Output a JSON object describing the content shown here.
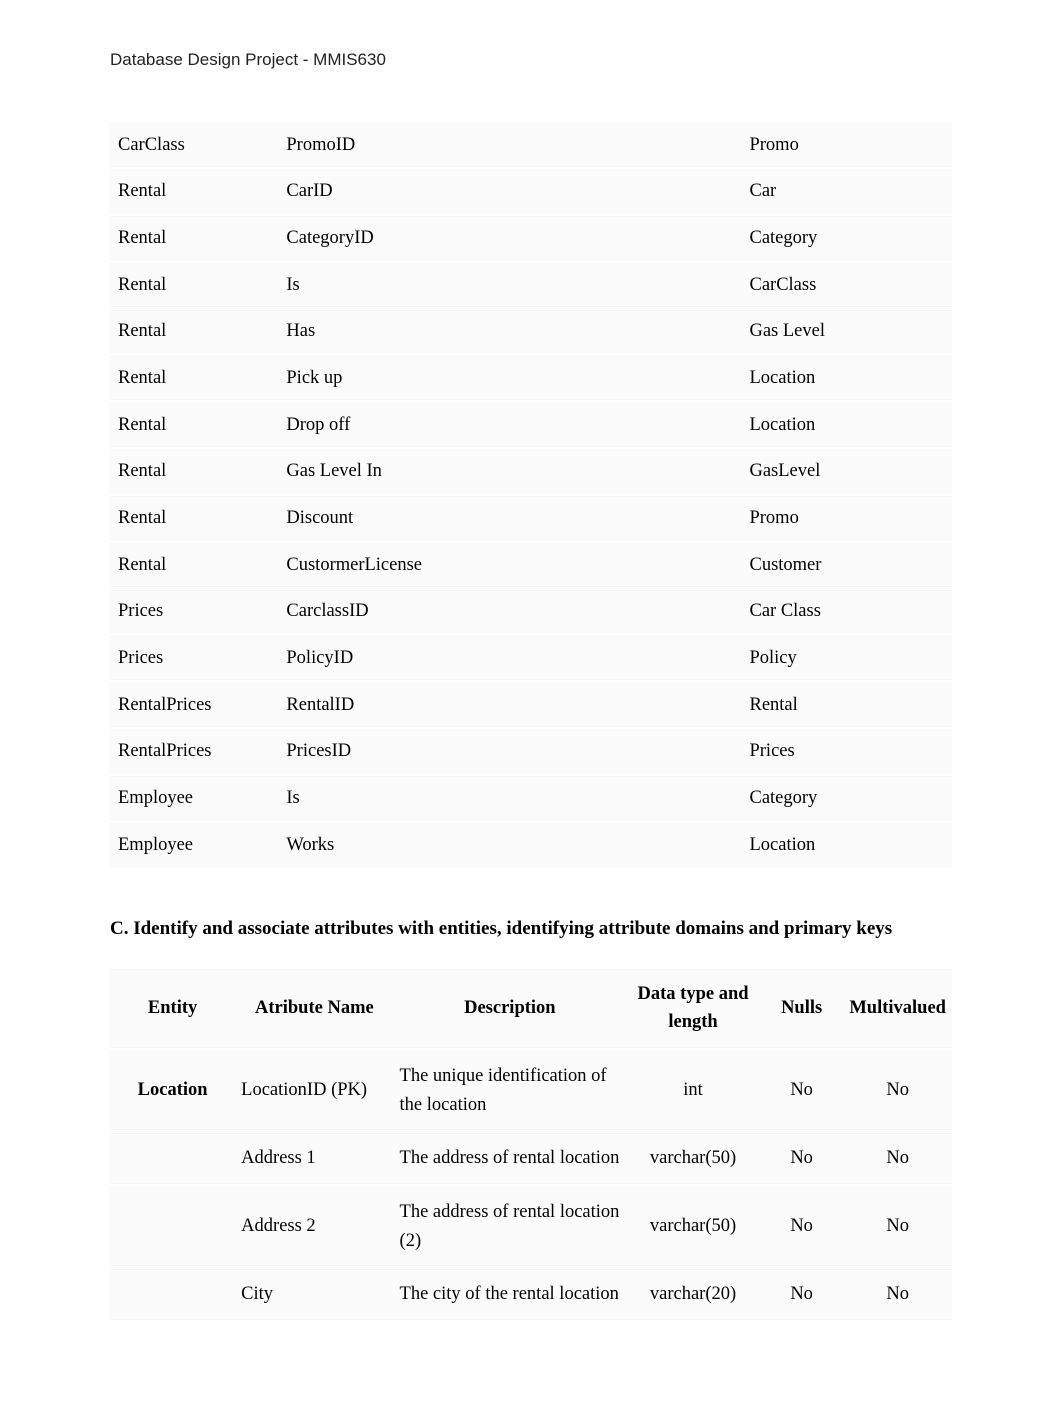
{
  "page_header": "Database Design Project - MMIS630",
  "relationship_rows": [
    {
      "left": "CarClass",
      "middle": "PromoID",
      "right": "Promo"
    },
    {
      "left": "Rental",
      "middle": "CarID",
      "right": "Car"
    },
    {
      "left": "Rental",
      "middle": "CategoryID",
      "right": "Category"
    },
    {
      "left": "Rental",
      "middle": "Is",
      "right": "CarClass"
    },
    {
      "left": "Rental",
      "middle": "Has",
      "right": "Gas Level"
    },
    {
      "left": "Rental",
      "middle": "Pick up",
      "right": "Location"
    },
    {
      "left": "Rental",
      "middle": "Drop off",
      "right": "Location"
    },
    {
      "left": "Rental",
      "middle": "Gas Level In",
      "right": "GasLevel"
    },
    {
      "left": "Rental",
      "middle": "Discount",
      "right": "Promo"
    },
    {
      "left": "Rental",
      "middle": "CustormerLicense",
      "right": "Customer"
    },
    {
      "left": "Prices",
      "middle": "CarclassID",
      "right": "Car Class"
    },
    {
      "left": "Prices",
      "middle": "PolicyID",
      "right": "Policy"
    },
    {
      "left": "RentalPrices",
      "middle": "RentalID",
      "right": "Rental"
    },
    {
      "left": "RentalPrices",
      "middle": "PricesID",
      "right": "Prices"
    },
    {
      "left": "Employee",
      "middle": "Is",
      "right": "Category"
    },
    {
      "left": "Employee",
      "middle": "Works",
      "right": "Location"
    }
  ],
  "section_c_heading": "C. Identify and associate attributes with entities, identifying attribute domains and primary keys",
  "attr_headers": {
    "entity": "Entity",
    "attribute": "Atribute Name",
    "description": "Description",
    "dtype": "Data type and length",
    "nulls": "Nulls",
    "multi": "Multivalued"
  },
  "attr_rows": [
    {
      "entity": "Location",
      "attribute": "LocationID (PK)",
      "description": "The unique identification of the location",
      "dtype": "int",
      "nulls": "No",
      "multi": "No"
    },
    {
      "entity": "",
      "attribute": "Address 1",
      "description": "The address of rental location",
      "dtype": "varchar(50)",
      "nulls": "No",
      "multi": "No"
    },
    {
      "entity": "",
      "attribute": "Address 2",
      "description": "The address of rental location (2)",
      "dtype": "varchar(50)",
      "nulls": "No",
      "multi": "No"
    },
    {
      "entity": "",
      "attribute": "City",
      "description": "The city of the rental location",
      "dtype": "varchar(20)",
      "nulls": "No",
      "multi": "No"
    }
  ]
}
